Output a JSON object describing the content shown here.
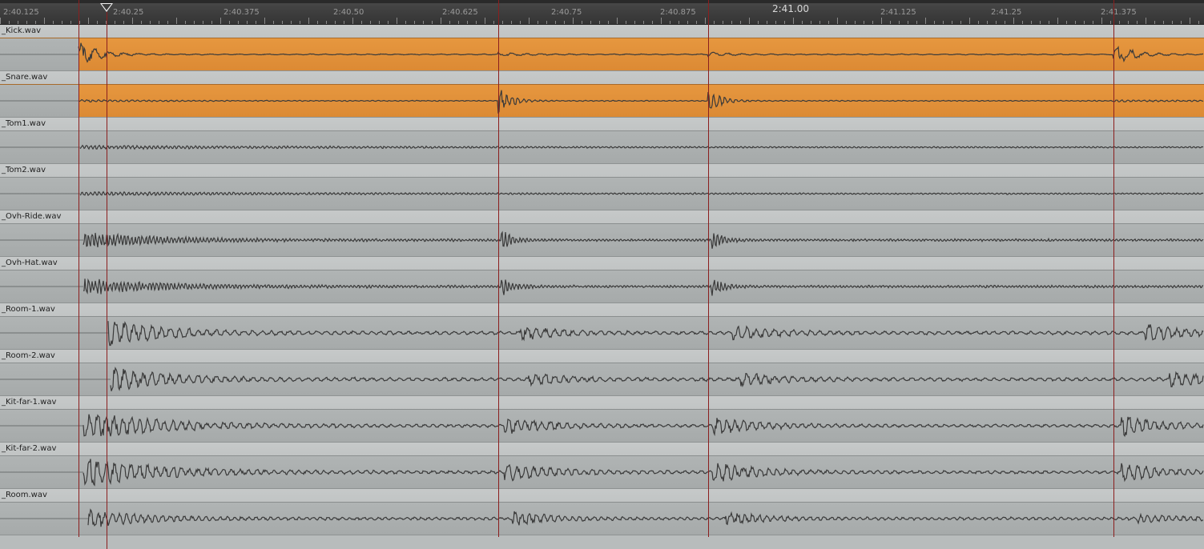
{
  "timeline": {
    "ruler_labels": [
      {
        "text": "2:40.125",
        "major": false
      },
      {
        "text": "2:40.25",
        "major": false
      },
      {
        "text": "2:40.375",
        "major": false
      },
      {
        "text": "2:40.50",
        "major": false
      },
      {
        "text": "2:40.625",
        "major": false
      },
      {
        "text": "2:40.75",
        "major": false
      },
      {
        "text": "2:40.875",
        "major": false
      },
      {
        "text": "2:41.00",
        "major": true
      },
      {
        "text": "2:41.125",
        "major": false
      },
      {
        "text": "2:41.25",
        "major": false
      },
      {
        "text": "2:41.375",
        "major": false
      }
    ]
  },
  "tracks": [
    {
      "name": "_Kick.wav",
      "selected": true
    },
    {
      "name": "_Snare.wav",
      "selected": true
    },
    {
      "name": "_Tom1.wav",
      "selected": false
    },
    {
      "name": "_Tom2.wav",
      "selected": false
    },
    {
      "name": "_Ovh-Ride.wav",
      "selected": false
    },
    {
      "name": "_Ovh-Hat.wav",
      "selected": false
    },
    {
      "name": "_Room-1.wav",
      "selected": false
    },
    {
      "name": "_Room-2.wav",
      "selected": false
    },
    {
      "name": "_Kit-far-1.wav",
      "selected": false
    },
    {
      "name": "_Kit-far-2.wav",
      "selected": false
    },
    {
      "name": "_Room.wav",
      "selected": false
    }
  ],
  "colors": {
    "selected_clip": "#dc8a34",
    "unselected_clip": "#a9adad",
    "waveform": "#3a3a3a",
    "marker": "#8b1e1e",
    "ruler_background": "#3c3c3c"
  },
  "icons": {
    "playhead": "playhead-triangle-icon"
  }
}
